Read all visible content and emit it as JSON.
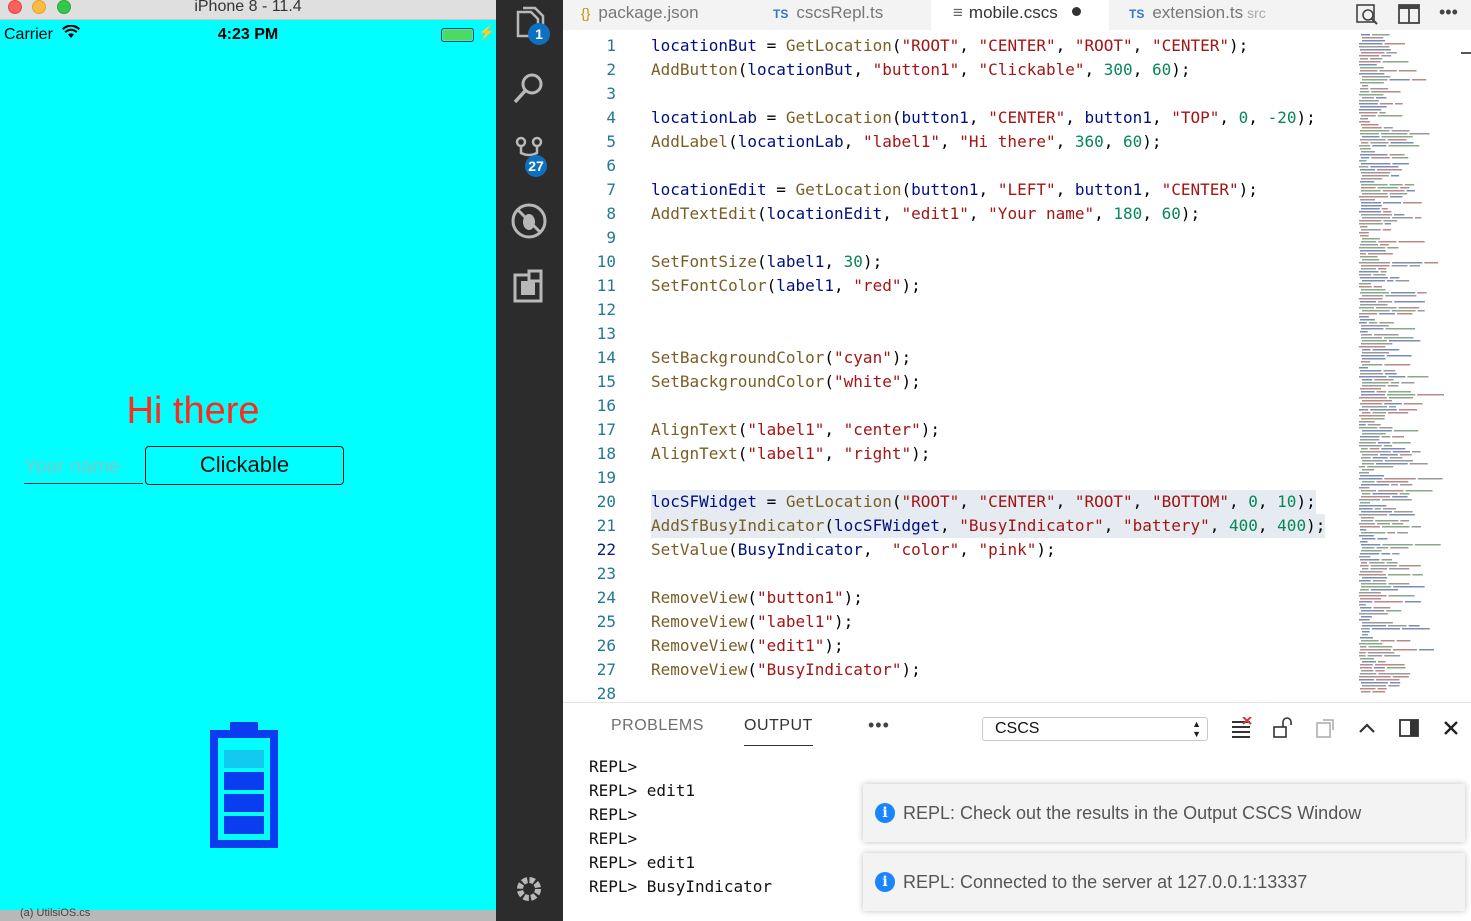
{
  "simulator": {
    "title": "iPhone 8 - 11.4",
    "carrier": "Carrier",
    "time": "4:23 PM",
    "label_text": "Hi there",
    "label_color": "#ff2a1a",
    "textedit_placeholder": "Your name",
    "button_label": "Clickable",
    "background": "#00ffff",
    "bottom_text": "(a) UtilsiOS.cs"
  },
  "activity_bar": {
    "explorer_badge": "1",
    "scm_badge": "27",
    "icons": [
      "files-icon",
      "search-icon",
      "source-control-icon",
      "debug-icon",
      "extensions-icon",
      "gear-icon"
    ]
  },
  "tabs": [
    {
      "label": "package.json",
      "kind": "{}"
    },
    {
      "label": "cscsRepl.ts",
      "kind": "TS"
    },
    {
      "label": "mobile.cscs",
      "kind": "file",
      "active": true,
      "dirty": true
    },
    {
      "label": "extension.ts",
      "kind": "TS",
      "hint": "src"
    }
  ],
  "editor": {
    "current_line": 22,
    "selected_lines": [
      20,
      21
    ],
    "lines": [
      {
        "n": "1",
        "t": [
          [
            "var",
            "locationBut"
          ],
          [
            "p",
            " = "
          ],
          [
            "fn",
            "GetLocation"
          ],
          [
            "p",
            "("
          ],
          [
            "str",
            "\"ROOT\""
          ],
          [
            "p",
            ", "
          ],
          [
            "str",
            "\"CENTER\""
          ],
          [
            "p",
            ", "
          ],
          [
            "str",
            "\"ROOT\""
          ],
          [
            "p",
            ", "
          ],
          [
            "str",
            "\"CENTER\""
          ],
          [
            "p",
            ");"
          ]
        ]
      },
      {
        "n": "2",
        "t": [
          [
            "fn",
            "AddButton"
          ],
          [
            "p",
            "("
          ],
          [
            "var",
            "locationBut"
          ],
          [
            "p",
            ", "
          ],
          [
            "str",
            "\"button1\""
          ],
          [
            "p",
            ", "
          ],
          [
            "str",
            "\"Clickable\""
          ],
          [
            "p",
            ", "
          ],
          [
            "num",
            "300"
          ],
          [
            "p",
            ", "
          ],
          [
            "num",
            "60"
          ],
          [
            "p",
            ");"
          ]
        ]
      },
      {
        "n": "3",
        "t": []
      },
      {
        "n": "4",
        "t": [
          [
            "var",
            "locationLab"
          ],
          [
            "p",
            " = "
          ],
          [
            "fn",
            "GetLocation"
          ],
          [
            "p",
            "("
          ],
          [
            "var",
            "button1"
          ],
          [
            "p",
            ", "
          ],
          [
            "str",
            "\"CENTER\""
          ],
          [
            "p",
            ", "
          ],
          [
            "var",
            "button1"
          ],
          [
            "p",
            ", "
          ],
          [
            "str",
            "\"TOP\""
          ],
          [
            "p",
            ", "
          ],
          [
            "num",
            "0"
          ],
          [
            "p",
            ", "
          ],
          [
            "num",
            "-20"
          ],
          [
            "p",
            ");"
          ]
        ]
      },
      {
        "n": "5",
        "t": [
          [
            "fn",
            "AddLabel"
          ],
          [
            "p",
            "("
          ],
          [
            "var",
            "locationLab"
          ],
          [
            "p",
            ", "
          ],
          [
            "str",
            "\"label1\""
          ],
          [
            "p",
            ", "
          ],
          [
            "str",
            "\"Hi there\""
          ],
          [
            "p",
            ", "
          ],
          [
            "num",
            "360"
          ],
          [
            "p",
            ", "
          ],
          [
            "num",
            "60"
          ],
          [
            "p",
            ");"
          ]
        ]
      },
      {
        "n": "6",
        "t": []
      },
      {
        "n": "7",
        "t": [
          [
            "var",
            "locationEdit"
          ],
          [
            "p",
            " = "
          ],
          [
            "fn",
            "GetLocation"
          ],
          [
            "p",
            "("
          ],
          [
            "var",
            "button1"
          ],
          [
            "p",
            ", "
          ],
          [
            "str",
            "\"LEFT\""
          ],
          [
            "p",
            ", "
          ],
          [
            "var",
            "button1"
          ],
          [
            "p",
            ", "
          ],
          [
            "str",
            "\"CENTER\""
          ],
          [
            "p",
            ");"
          ]
        ]
      },
      {
        "n": "8",
        "t": [
          [
            "fn",
            "AddTextEdit"
          ],
          [
            "p",
            "("
          ],
          [
            "var",
            "locationEdit"
          ],
          [
            "p",
            ", "
          ],
          [
            "str",
            "\"edit1\""
          ],
          [
            "p",
            ", "
          ],
          [
            "str",
            "\"Your name\""
          ],
          [
            "p",
            ", "
          ],
          [
            "num",
            "180"
          ],
          [
            "p",
            ", "
          ],
          [
            "num",
            "60"
          ],
          [
            "p",
            ");"
          ]
        ]
      },
      {
        "n": "9",
        "t": []
      },
      {
        "n": "10",
        "t": [
          [
            "fn",
            "SetFontSize"
          ],
          [
            "p",
            "("
          ],
          [
            "var",
            "label1"
          ],
          [
            "p",
            ", "
          ],
          [
            "num",
            "30"
          ],
          [
            "p",
            ");"
          ]
        ]
      },
      {
        "n": "11",
        "t": [
          [
            "fn",
            "SetFontColor"
          ],
          [
            "p",
            "("
          ],
          [
            "var",
            "label1"
          ],
          [
            "p",
            ", "
          ],
          [
            "str",
            "\"red\""
          ],
          [
            "p",
            ");"
          ]
        ]
      },
      {
        "n": "12",
        "t": []
      },
      {
        "n": "13",
        "t": []
      },
      {
        "n": "14",
        "t": [
          [
            "fn",
            "SetBackgroundColor"
          ],
          [
            "p",
            "("
          ],
          [
            "str",
            "\"cyan\""
          ],
          [
            "p",
            ");"
          ]
        ]
      },
      {
        "n": "15",
        "t": [
          [
            "fn",
            "SetBackgroundColor"
          ],
          [
            "p",
            "("
          ],
          [
            "str",
            "\"white\""
          ],
          [
            "p",
            ");"
          ]
        ]
      },
      {
        "n": "16",
        "t": []
      },
      {
        "n": "17",
        "t": [
          [
            "fn",
            "AlignText"
          ],
          [
            "p",
            "("
          ],
          [
            "str",
            "\"label1\""
          ],
          [
            "p",
            ", "
          ],
          [
            "str",
            "\"center\""
          ],
          [
            "p",
            ");"
          ]
        ]
      },
      {
        "n": "18",
        "t": [
          [
            "fn",
            "AlignText"
          ],
          [
            "p",
            "("
          ],
          [
            "str",
            "\"label1\""
          ],
          [
            "p",
            ", "
          ],
          [
            "str",
            "\"right\""
          ],
          [
            "p",
            ");"
          ]
        ]
      },
      {
        "n": "19",
        "t": []
      },
      {
        "n": "20",
        "t": [
          [
            "var",
            "locSFWidget"
          ],
          [
            "p",
            " = "
          ],
          [
            "fn",
            "GetLocation"
          ],
          [
            "p",
            "("
          ],
          [
            "str",
            "\"ROOT\""
          ],
          [
            "p",
            ", "
          ],
          [
            "str",
            "\"CENTER\""
          ],
          [
            "p",
            ", "
          ],
          [
            "str",
            "\"ROOT\""
          ],
          [
            "p",
            ", "
          ],
          [
            "str",
            "\"BOTTOM\""
          ],
          [
            "p",
            ", "
          ],
          [
            "num",
            "0"
          ],
          [
            "p",
            ", "
          ],
          [
            "num",
            "10"
          ],
          [
            "p",
            ");"
          ]
        ]
      },
      {
        "n": "21",
        "t": [
          [
            "fn",
            "AddSfBusyIndicator"
          ],
          [
            "p",
            "("
          ],
          [
            "var",
            "locSFWidget"
          ],
          [
            "p",
            ", "
          ],
          [
            "str",
            "\"BusyIndicator\""
          ],
          [
            "p",
            ", "
          ],
          [
            "str",
            "\"battery\""
          ],
          [
            "p",
            ", "
          ],
          [
            "num",
            "400"
          ],
          [
            "p",
            ", "
          ],
          [
            "num",
            "400"
          ],
          [
            "p",
            ");"
          ]
        ]
      },
      {
        "n": "22",
        "t": [
          [
            "fn",
            "SetValue"
          ],
          [
            "p",
            "("
          ],
          [
            "var",
            "BusyIndicator"
          ],
          [
            "p",
            ",  "
          ],
          [
            "str",
            "\"color\""
          ],
          [
            "p",
            ", "
          ],
          [
            "str",
            "\"pink\""
          ],
          [
            "p",
            ");"
          ]
        ]
      },
      {
        "n": "23",
        "t": []
      },
      {
        "n": "24",
        "t": [
          [
            "fn",
            "RemoveView"
          ],
          [
            "p",
            "("
          ],
          [
            "str",
            "\"button1\""
          ],
          [
            "p",
            ");"
          ]
        ]
      },
      {
        "n": "25",
        "t": [
          [
            "fn",
            "RemoveView"
          ],
          [
            "p",
            "("
          ],
          [
            "str",
            "\"label1\""
          ],
          [
            "p",
            ");"
          ]
        ]
      },
      {
        "n": "26",
        "t": [
          [
            "fn",
            "RemoveView"
          ],
          [
            "p",
            "("
          ],
          [
            "str",
            "\"edit1\""
          ],
          [
            "p",
            ");"
          ]
        ]
      },
      {
        "n": "27",
        "t": [
          [
            "fn",
            "RemoveView"
          ],
          [
            "p",
            "("
          ],
          [
            "str",
            "\"BusyIndicator\""
          ],
          [
            "p",
            ");"
          ]
        ]
      },
      {
        "n": "28",
        "t": []
      }
    ]
  },
  "panel": {
    "tabs": [
      "PROBLEMS",
      "OUTPUT"
    ],
    "active_tab": "OUTPUT",
    "more": "•••",
    "channel": "CSCS",
    "output_lines": [
      "REPL>",
      "REPL> edit1",
      "REPL>",
      "REPL>",
      "REPL> edit1",
      "REPL> BusyIndicator"
    ]
  },
  "notifications": [
    "REPL: Check out the results in the Output CSCS Window",
    "REPL: Connected to the server at 127.0.0.1:13337"
  ]
}
